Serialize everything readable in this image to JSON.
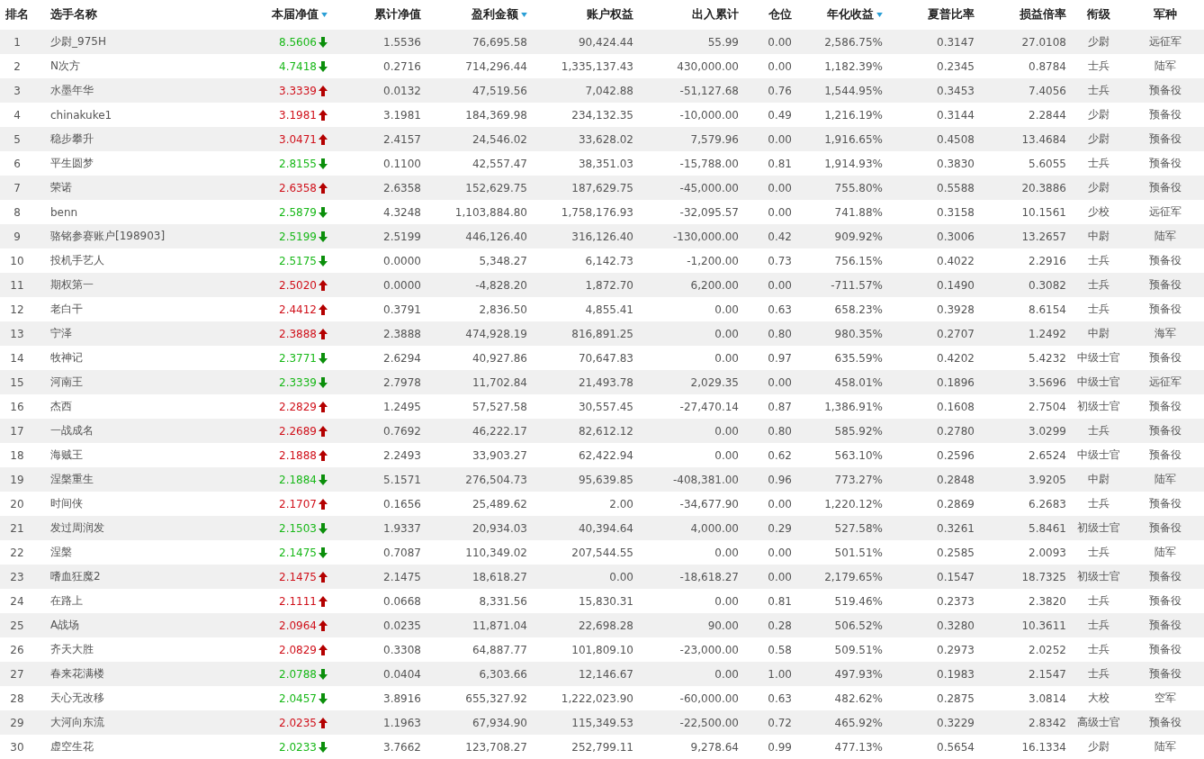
{
  "columns": [
    {
      "label": "排名",
      "kind": "rank",
      "sorted": false
    },
    {
      "label": "选手名称",
      "kind": "name",
      "sorted": false
    },
    {
      "label": "本届净值",
      "kind": "net",
      "sorted": true
    },
    {
      "label": "累计净值",
      "kind": "num",
      "sorted": false
    },
    {
      "label": "盈利金额",
      "kind": "num",
      "sorted": true
    },
    {
      "label": "账户权益",
      "kind": "num",
      "sorted": false
    },
    {
      "label": "出入累计",
      "kind": "num",
      "sorted": false
    },
    {
      "label": "仓位",
      "kind": "num",
      "sorted": false
    },
    {
      "label": "年化收益",
      "kind": "num",
      "sorted": true
    },
    {
      "label": "夏普比率",
      "kind": "num",
      "sorted": false
    },
    {
      "label": "损益倍率",
      "kind": "num",
      "sorted": false
    },
    {
      "label": "衔级",
      "kind": "tag",
      "sorted": false
    },
    {
      "label": "军种",
      "kind": "tag",
      "sorted": false
    }
  ],
  "rows": [
    {
      "rising": false,
      "cells": [
        "1",
        "少尉_975H",
        "8.5606",
        "1.5536",
        "76,695.58",
        "90,424.44",
        "55.99",
        "0.00",
        "2,586.75%",
        "0.3147",
        "27.0108",
        "少尉",
        "远征军"
      ]
    },
    {
      "rising": false,
      "cells": [
        "2",
        "N次方",
        "4.7418",
        "0.2716",
        "714,296.44",
        "1,335,137.43",
        "430,000.00",
        "0.00",
        "1,182.39%",
        "0.2345",
        "0.8784",
        "士兵",
        "陆军"
      ]
    },
    {
      "rising": true,
      "cells": [
        "3",
        "水墨年华",
        "3.3339",
        "0.0132",
        "47,519.56",
        "7,042.88",
        "-51,127.68",
        "0.76",
        "1,544.95%",
        "0.3453",
        "7.4056",
        "士兵",
        "预备役"
      ]
    },
    {
      "rising": true,
      "cells": [
        "4",
        "chinakuke1",
        "3.1981",
        "3.1981",
        "184,369.98",
        "234,132.35",
        "-10,000.00",
        "0.49",
        "1,216.19%",
        "0.3144",
        "2.2844",
        "少尉",
        "预备役"
      ]
    },
    {
      "rising": true,
      "cells": [
        "5",
        "稳步攀升",
        "3.0471",
        "2.4157",
        "24,546.02",
        "33,628.02",
        "7,579.96",
        "0.00",
        "1,916.65%",
        "0.4508",
        "13.4684",
        "少尉",
        "预备役"
      ]
    },
    {
      "rising": false,
      "cells": [
        "6",
        "平生圆梦",
        "2.8155",
        "0.1100",
        "42,557.47",
        "38,351.03",
        "-15,788.00",
        "0.81",
        "1,914.93%",
        "0.3830",
        "5.6055",
        "士兵",
        "预备役"
      ]
    },
    {
      "rising": true,
      "cells": [
        "7",
        "荣诺",
        "2.6358",
        "2.6358",
        "152,629.75",
        "187,629.75",
        "-45,000.00",
        "0.00",
        "755.80%",
        "0.5588",
        "20.3886",
        "少尉",
        "预备役"
      ]
    },
    {
      "rising": false,
      "cells": [
        "8",
        "benn",
        "2.5879",
        "4.3248",
        "1,103,884.80",
        "1,758,176.93",
        "-32,095.57",
        "0.00",
        "741.88%",
        "0.3158",
        "10.1561",
        "少校",
        "远征军"
      ]
    },
    {
      "rising": false,
      "cells": [
        "9",
        "骆铭参赛账户[198903]",
        "2.5199",
        "2.5199",
        "446,126.40",
        "316,126.40",
        "-130,000.00",
        "0.42",
        "909.92%",
        "0.3006",
        "13.2657",
        "中尉",
        "陆军"
      ]
    },
    {
      "rising": false,
      "cells": [
        "10",
        "投机手艺人",
        "2.5175",
        "0.0000",
        "5,348.27",
        "6,142.73",
        "-1,200.00",
        "0.73",
        "756.15%",
        "0.4022",
        "2.2916",
        "士兵",
        "预备役"
      ]
    },
    {
      "rising": true,
      "cells": [
        "11",
        "期权第一",
        "2.5020",
        "0.0000",
        "-4,828.20",
        "1,872.70",
        "6,200.00",
        "0.00",
        "-711.57%",
        "0.1490",
        "0.3082",
        "士兵",
        "预备役"
      ]
    },
    {
      "rising": true,
      "cells": [
        "12",
        "老白干",
        "2.4412",
        "0.3791",
        "2,836.50",
        "4,855.41",
        "0.00",
        "0.63",
        "658.23%",
        "0.3928",
        "8.6154",
        "士兵",
        "预备役"
      ]
    },
    {
      "rising": true,
      "cells": [
        "13",
        "宁泽",
        "2.3888",
        "2.3888",
        "474,928.19",
        "816,891.25",
        "0.00",
        "0.80",
        "980.35%",
        "0.2707",
        "1.2492",
        "中尉",
        "海军"
      ]
    },
    {
      "rising": false,
      "cells": [
        "14",
        "牧神记",
        "2.3771",
        "2.6294",
        "40,927.86",
        "70,647.83",
        "0.00",
        "0.97",
        "635.59%",
        "0.4202",
        "5.4232",
        "中级士官",
        "预备役"
      ]
    },
    {
      "rising": false,
      "cells": [
        "15",
        "河南王",
        "2.3339",
        "2.7978",
        "11,702.84",
        "21,493.78",
        "2,029.35",
        "0.00",
        "458.01%",
        "0.1896",
        "3.5696",
        "中级士官",
        "远征军"
      ]
    },
    {
      "rising": true,
      "cells": [
        "16",
        "杰西",
        "2.2829",
        "1.2495",
        "57,527.58",
        "30,557.45",
        "-27,470.14",
        "0.87",
        "1,386.91%",
        "0.1608",
        "2.7504",
        "初级士官",
        "预备役"
      ]
    },
    {
      "rising": true,
      "cells": [
        "17",
        "一战成名",
        "2.2689",
        "0.7692",
        "46,222.17",
        "82,612.12",
        "0.00",
        "0.80",
        "585.92%",
        "0.2780",
        "3.0299",
        "士兵",
        "预备役"
      ]
    },
    {
      "rising": true,
      "cells": [
        "18",
        "海贼王",
        "2.1888",
        "2.2493",
        "33,903.27",
        "62,422.94",
        "0.00",
        "0.62",
        "563.10%",
        "0.2596",
        "2.6524",
        "中级士官",
        "预备役"
      ]
    },
    {
      "rising": false,
      "cells": [
        "19",
        "涅槃重生",
        "2.1884",
        "5.1571",
        "276,504.73",
        "95,639.85",
        "-408,381.00",
        "0.96",
        "773.27%",
        "0.2848",
        "3.9205",
        "中尉",
        "陆军"
      ]
    },
    {
      "rising": true,
      "cells": [
        "20",
        "时间侠",
        "2.1707",
        "0.1656",
        "25,489.62",
        "2.00",
        "-34,677.90",
        "0.00",
        "1,220.12%",
        "0.2869",
        "6.2683",
        "士兵",
        "预备役"
      ]
    },
    {
      "rising": false,
      "cells": [
        "21",
        "发过周润发",
        "2.1503",
        "1.9337",
        "20,934.03",
        "40,394.64",
        "4,000.00",
        "0.29",
        "527.58%",
        "0.3261",
        "5.8461",
        "初级士官",
        "预备役"
      ]
    },
    {
      "rising": false,
      "cells": [
        "22",
        "涅槃",
        "2.1475",
        "0.7087",
        "110,349.02",
        "207,544.55",
        "0.00",
        "0.00",
        "501.51%",
        "0.2585",
        "2.0093",
        "士兵",
        "陆军"
      ]
    },
    {
      "rising": true,
      "cells": [
        "23",
        "嗜血狂魔2",
        "2.1475",
        "2.1475",
        "18,618.27",
        "0.00",
        "-18,618.27",
        "0.00",
        "2,179.65%",
        "0.1547",
        "18.7325",
        "初级士官",
        "预备役"
      ]
    },
    {
      "rising": true,
      "cells": [
        "24",
        "在路上",
        "2.1111",
        "0.0668",
        "8,331.56",
        "15,830.31",
        "0.00",
        "0.81",
        "519.46%",
        "0.2373",
        "2.3820",
        "士兵",
        "预备役"
      ]
    },
    {
      "rising": true,
      "cells": [
        "25",
        "A战场",
        "2.0964",
        "0.0235",
        "11,871.04",
        "22,698.28",
        "90.00",
        "0.28",
        "506.52%",
        "0.3280",
        "10.3611",
        "士兵",
        "预备役"
      ]
    },
    {
      "rising": true,
      "cells": [
        "26",
        "齐天大胜",
        "2.0829",
        "0.3308",
        "64,887.77",
        "101,809.10",
        "-23,000.00",
        "0.58",
        "509.51%",
        "0.2973",
        "2.0252",
        "士兵",
        "预备役"
      ]
    },
    {
      "rising": false,
      "cells": [
        "27",
        "春来花满楼",
        "2.0788",
        "0.0404",
        "6,303.66",
        "12,146.67",
        "0.00",
        "1.00",
        "497.93%",
        "0.1983",
        "2.1547",
        "士兵",
        "预备役"
      ]
    },
    {
      "rising": false,
      "cells": [
        "28",
        "天心无改移",
        "2.0457",
        "3.8916",
        "655,327.92",
        "1,222,023.90",
        "-60,000.00",
        "0.63",
        "482.62%",
        "0.2875",
        "3.0814",
        "大校",
        "空军"
      ]
    },
    {
      "rising": true,
      "cells": [
        "29",
        "大河向东流",
        "2.0235",
        "1.1963",
        "67,934.90",
        "115,349.53",
        "-22,500.00",
        "0.72",
        "465.92%",
        "0.3229",
        "2.8342",
        "高级士官",
        "预备役"
      ]
    },
    {
      "rising": false,
      "cells": [
        "30",
        "虚空生花",
        "2.0233",
        "3.7662",
        "123,708.27",
        "252,799.11",
        "9,278.64",
        "0.99",
        "477.13%",
        "0.5654",
        "16.1334",
        "少尉",
        "陆军"
      ]
    }
  ]
}
